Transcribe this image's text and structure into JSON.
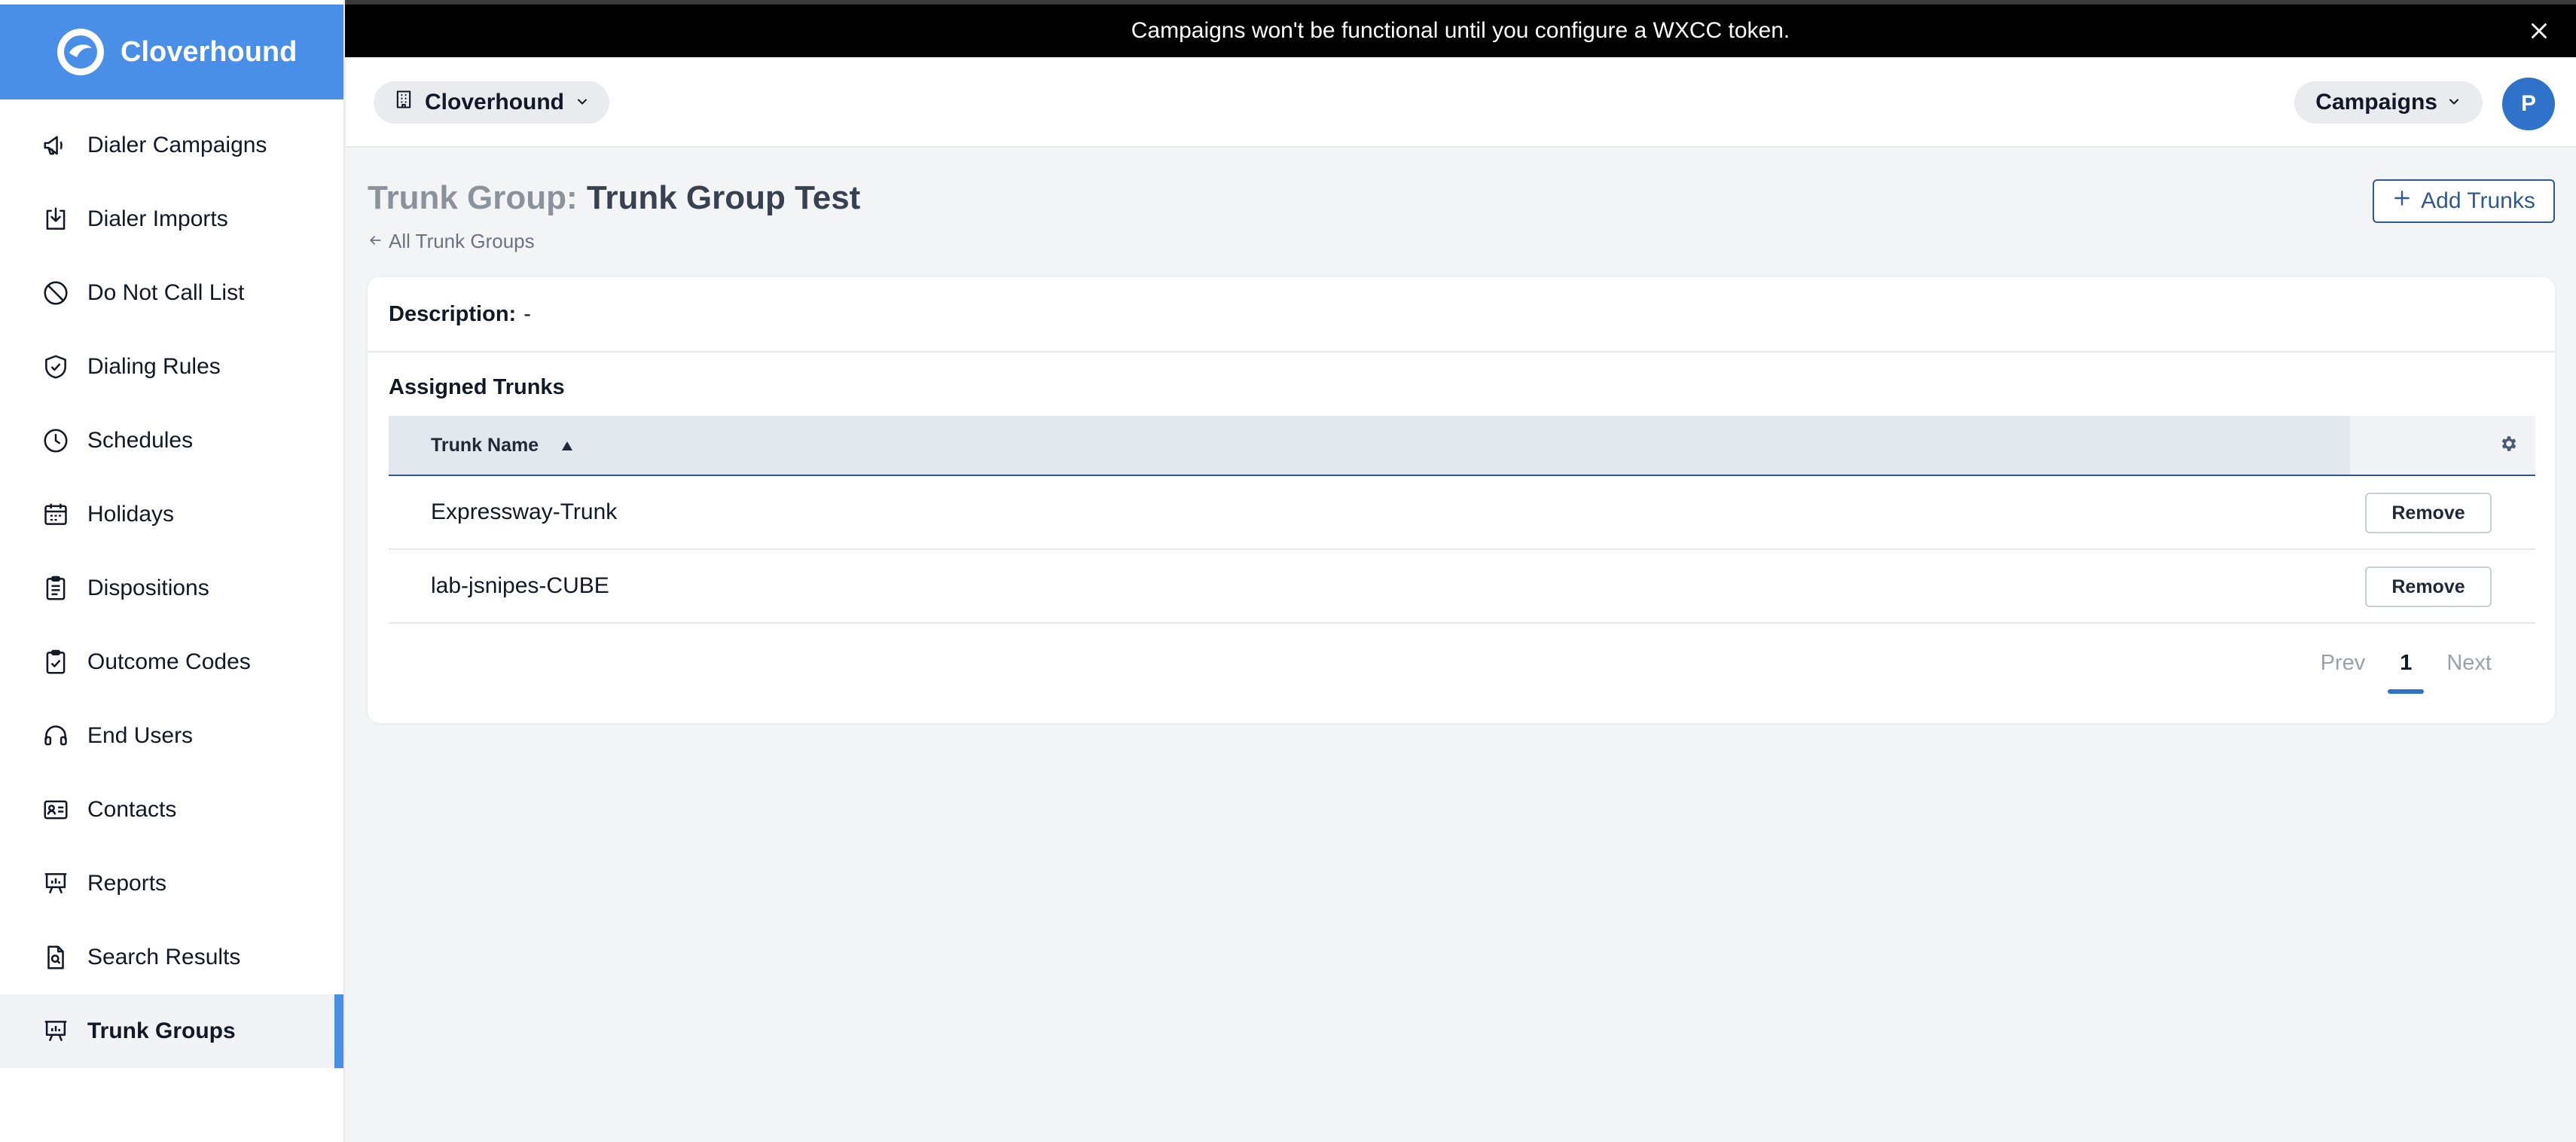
{
  "brand": {
    "name": "Cloverhound"
  },
  "banner": {
    "message": "Campaigns won't be functional until you configure a WXCC token."
  },
  "header": {
    "org": "Cloverhound",
    "app": "Campaigns",
    "avatar_initial": "P"
  },
  "sidebar": {
    "items": [
      {
        "label": "Dialer Campaigns",
        "icon": "megaphone-icon",
        "active": false
      },
      {
        "label": "Dialer Imports",
        "icon": "import-icon",
        "active": false
      },
      {
        "label": "Do Not Call List",
        "icon": "prohibited-icon",
        "active": false
      },
      {
        "label": "Dialing Rules",
        "icon": "shield-check-icon",
        "active": false
      },
      {
        "label": "Schedules",
        "icon": "clock-icon",
        "active": false
      },
      {
        "label": "Holidays",
        "icon": "calendar-icon",
        "active": false
      },
      {
        "label": "Dispositions",
        "icon": "clipboard-icon",
        "active": false
      },
      {
        "label": "Outcome Codes",
        "icon": "clipboard-check-icon",
        "active": false
      },
      {
        "label": "End Users",
        "icon": "headset-icon",
        "active": false
      },
      {
        "label": "Contacts",
        "icon": "contact-card-icon",
        "active": false
      },
      {
        "label": "Reports",
        "icon": "presentation-chart-icon",
        "active": false
      },
      {
        "label": "Search Results",
        "icon": "document-search-icon",
        "active": false
      },
      {
        "label": "Trunk Groups",
        "icon": "presentation-chart-icon",
        "active": true
      }
    ]
  },
  "page": {
    "title_prefix": "Trunk Group:",
    "title_name": "Trunk Group Test",
    "back_link": "All Trunk Groups",
    "add_button": "Add Trunks"
  },
  "card": {
    "description_label": "Description:",
    "description_value": "-",
    "section_title": "Assigned Trunks",
    "column_header": "Trunk Name",
    "rows": [
      {
        "name": "Expressway-Trunk",
        "action": "Remove"
      },
      {
        "name": "lab-jsnipes-CUBE",
        "action": "Remove"
      }
    ]
  },
  "pagination": {
    "prev": "Prev",
    "current": "1",
    "next": "Next"
  },
  "colors": {
    "brand_blue": "#4a8fe7",
    "accent_dark_blue": "#2f5a8f",
    "avatar_blue": "#2f72c9"
  }
}
